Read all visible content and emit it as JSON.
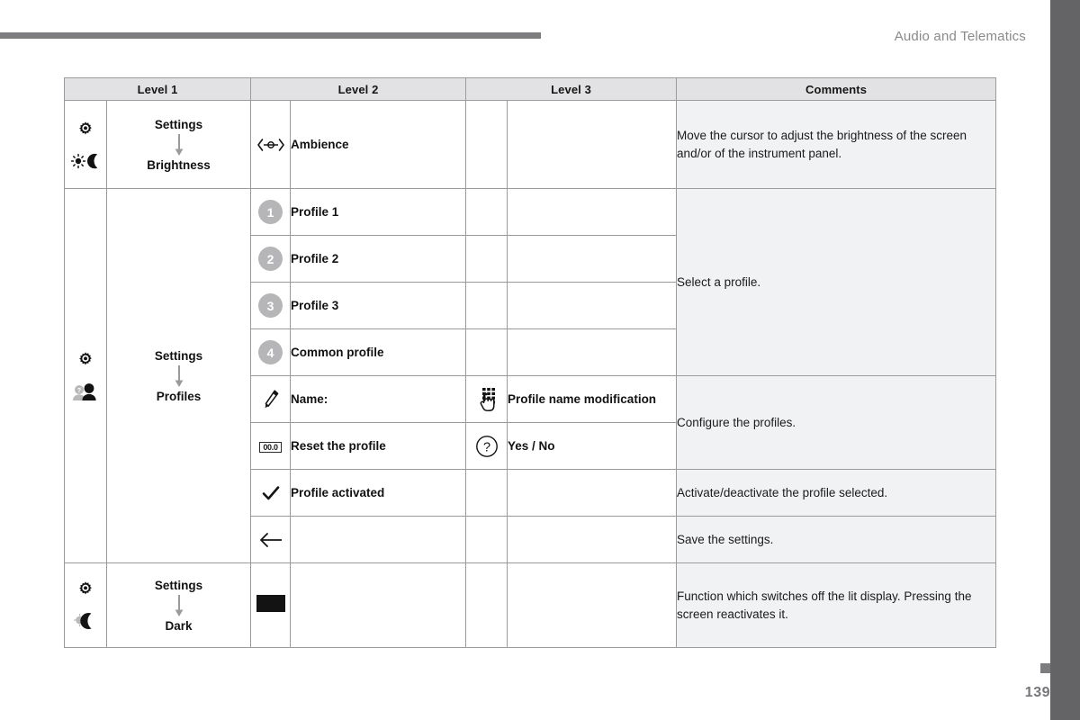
{
  "page": {
    "header_title": "Audio and Telematics",
    "page_number": "139"
  },
  "table": {
    "headers": [
      "Level 1",
      "Level 2",
      "Level 3",
      "Comments"
    ],
    "groups": [
      {
        "level1": {
          "icons": [
            "gear-icon",
            "sun-moon-icon"
          ],
          "path": [
            "Settings",
            "Brightness"
          ]
        },
        "rows": [
          {
            "level2_icon": "cursor-adjust-icon",
            "level2": "Ambience",
            "level3_icon": "",
            "level3": "",
            "comment": "Move the cursor to adjust the brightness of the screen and/or of the instrument panel."
          }
        ]
      },
      {
        "level1": {
          "icons": [
            "gear-icon",
            "profiles-person-icon"
          ],
          "path": [
            "Settings",
            "Profiles"
          ]
        },
        "rows": [
          {
            "level2_icon": "badge-1",
            "level2": "Profile 1",
            "level3_icon": "",
            "level3": "",
            "comment": "Select a profile."
          },
          {
            "level2_icon": "badge-2",
            "level2": "Profile 2",
            "level3_icon": "",
            "level3": "",
            "comment": ""
          },
          {
            "level2_icon": "badge-3",
            "level2": "Profile 3",
            "level3_icon": "",
            "level3": "",
            "comment": ""
          },
          {
            "level2_icon": "badge-4",
            "level2": "Common profile",
            "level3_icon": "",
            "level3": "",
            "comment": ""
          },
          {
            "level2_icon": "pencil-icon",
            "level2": "Name:",
            "level3_icon": "keypad-hand-icon",
            "level3": "Profile name modification",
            "comment": "Configure the profiles."
          },
          {
            "level2_icon": "reset-00-icon",
            "level2": "Reset the profile",
            "level3_icon": "question-circle-icon",
            "level3": "Yes / No",
            "comment": ""
          },
          {
            "level2_icon": "check-icon",
            "level2": "Profile activated",
            "level3_icon": "",
            "level3": "",
            "comment": "Activate/deactivate the profile selected."
          },
          {
            "level2_icon": "back-arrow-icon",
            "level2": "",
            "level3_icon": "",
            "level3": "",
            "comment": "Save the settings."
          }
        ]
      },
      {
        "level1": {
          "icons": [
            "gear-icon",
            "moon-icon"
          ],
          "path": [
            "Settings",
            "Dark"
          ]
        },
        "rows": [
          {
            "level2_icon": "black-screen-icon",
            "level2": "",
            "level3_icon": "",
            "level3": "",
            "comment": "Function which switches off the lit display. Pressing the screen reactivates it."
          }
        ]
      }
    ],
    "cells": {
      "h0": "Level 1",
      "h1": "Level 2",
      "h2": "Level 3",
      "h3": "Comments",
      "g0_settings": "Settings",
      "g0_leaf": "Brightness",
      "g0_r0_l2": "Ambience",
      "g0_r0_comment": "Move the cursor to adjust the brightness of the screen and/or of the instrument panel.",
      "g1_settings": "Settings",
      "g1_leaf": "Profiles",
      "g1_r0_l2": "Profile 1",
      "g1_r1_l2": "Profile 2",
      "g1_r2_l2": "Profile 3",
      "g1_r3_l2": "Common profile",
      "g1_r4_l2": "Name:",
      "g1_r4_l3": "Profile name modification",
      "g1_r5_l2": "Reset the profile",
      "g1_r5_l3": "Yes / No",
      "g1_r6_l2": "Profile activated",
      "g1_select_comment": "Select a profile.",
      "g1_configure_comment": "Configure the profiles.",
      "g1_activate_comment": "Activate/deactivate the profile selected.",
      "g1_save_comment": "Save the settings.",
      "g2_settings": "Settings",
      "g2_leaf": "Dark",
      "g2_comment": "Function which switches off the lit display. Pressing the screen reactivates it.",
      "badge1": "1",
      "badge2": "2",
      "badge3": "3",
      "badge4": "4",
      "reset_glyph": "00.0"
    },
    "colors": {
      "header_fill": "#e2e2e4",
      "comment_fill": "#f1f2f4",
      "border": "#9b9b9d",
      "badge_fill": "#b6b6b8",
      "edge_bar": "#646466"
    }
  }
}
